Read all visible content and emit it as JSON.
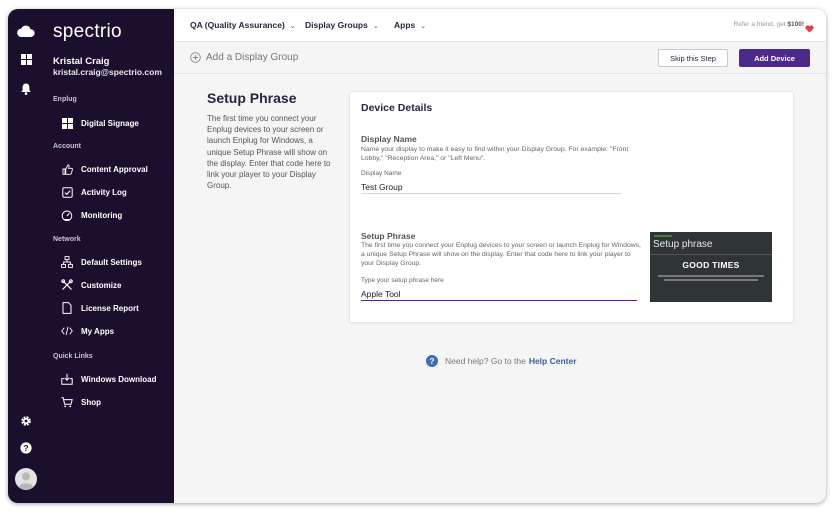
{
  "brand": {
    "logo_text": "spectrio",
    "accent_color": "#4b2a8c",
    "sidebar_bg": "#1b0f2e"
  },
  "user": {
    "name": "Kristal Craig",
    "email": "kristal.craig@spectrio.com"
  },
  "sidebar": {
    "sections": [
      {
        "label": "Enplug",
        "items": [
          {
            "label": "Digital Signage",
            "icon": "grid-icon"
          }
        ]
      },
      {
        "label": "Account",
        "items": [
          {
            "label": "Content Approval",
            "icon": "thumbs-up-icon"
          },
          {
            "label": "Activity Log",
            "icon": "checkbox-icon"
          },
          {
            "label": "Monitoring",
            "icon": "gauge-icon"
          }
        ]
      },
      {
        "label": "Network",
        "items": [
          {
            "label": "Default Settings",
            "icon": "network-icon"
          },
          {
            "label": "Customize",
            "icon": "tools-icon"
          },
          {
            "label": "License Report",
            "icon": "document-icon"
          },
          {
            "label": "My Apps",
            "icon": "code-icon"
          }
        ]
      },
      {
        "label": "Quick Links",
        "items": [
          {
            "label": "Windows Download",
            "icon": "download-icon"
          },
          {
            "label": "Shop",
            "icon": "cart-icon"
          }
        ]
      }
    ]
  },
  "rail": {
    "icons": [
      "cloud-icon",
      "apps-grid-icon",
      "bell-icon",
      "gear-icon",
      "help-icon",
      "avatar-icon"
    ]
  },
  "topbar": {
    "menus": [
      "QA (Quality Assurance)",
      "Display Groups",
      "Apps"
    ],
    "referral_prefix": "Refer a friend, get ",
    "referral_amount": "$100!"
  },
  "actionbar": {
    "add_group_label": "Add a Display Group",
    "skip_label": "Skip this Step",
    "add_device_label": "Add Device"
  },
  "info": {
    "title": "Setup Phrase",
    "text": "The first time you connect your Enplug devices to your screen or launch Enplug for Windows, a unique Setup Phrase will show on the display. Enter that code here to link your player to your Display Group."
  },
  "card": {
    "title": "Device Details",
    "display_name": {
      "title": "Display Name",
      "description": "Name your display to make it easy to find within your Display Group. For example: \"Front Lobby,\" \"Reception Area,\" or \"Left Menu\".",
      "label": "Display Name",
      "value": "Test Group"
    },
    "setup_phrase": {
      "title": "Setup Phrase",
      "description": "The first time you connect your Enplug devices to your screen or launch Enplug for Windows, a unique Setup Phrase will show on the display. Enter that code here to link your player to your Display Group.",
      "label": "Type your setup phrase here",
      "value": "Apple Tool"
    },
    "preview": {
      "title": "Setup phrase",
      "code": "GOOD TIMES"
    }
  },
  "help": {
    "text": "Need help? Go to the",
    "link": "Help Center"
  }
}
